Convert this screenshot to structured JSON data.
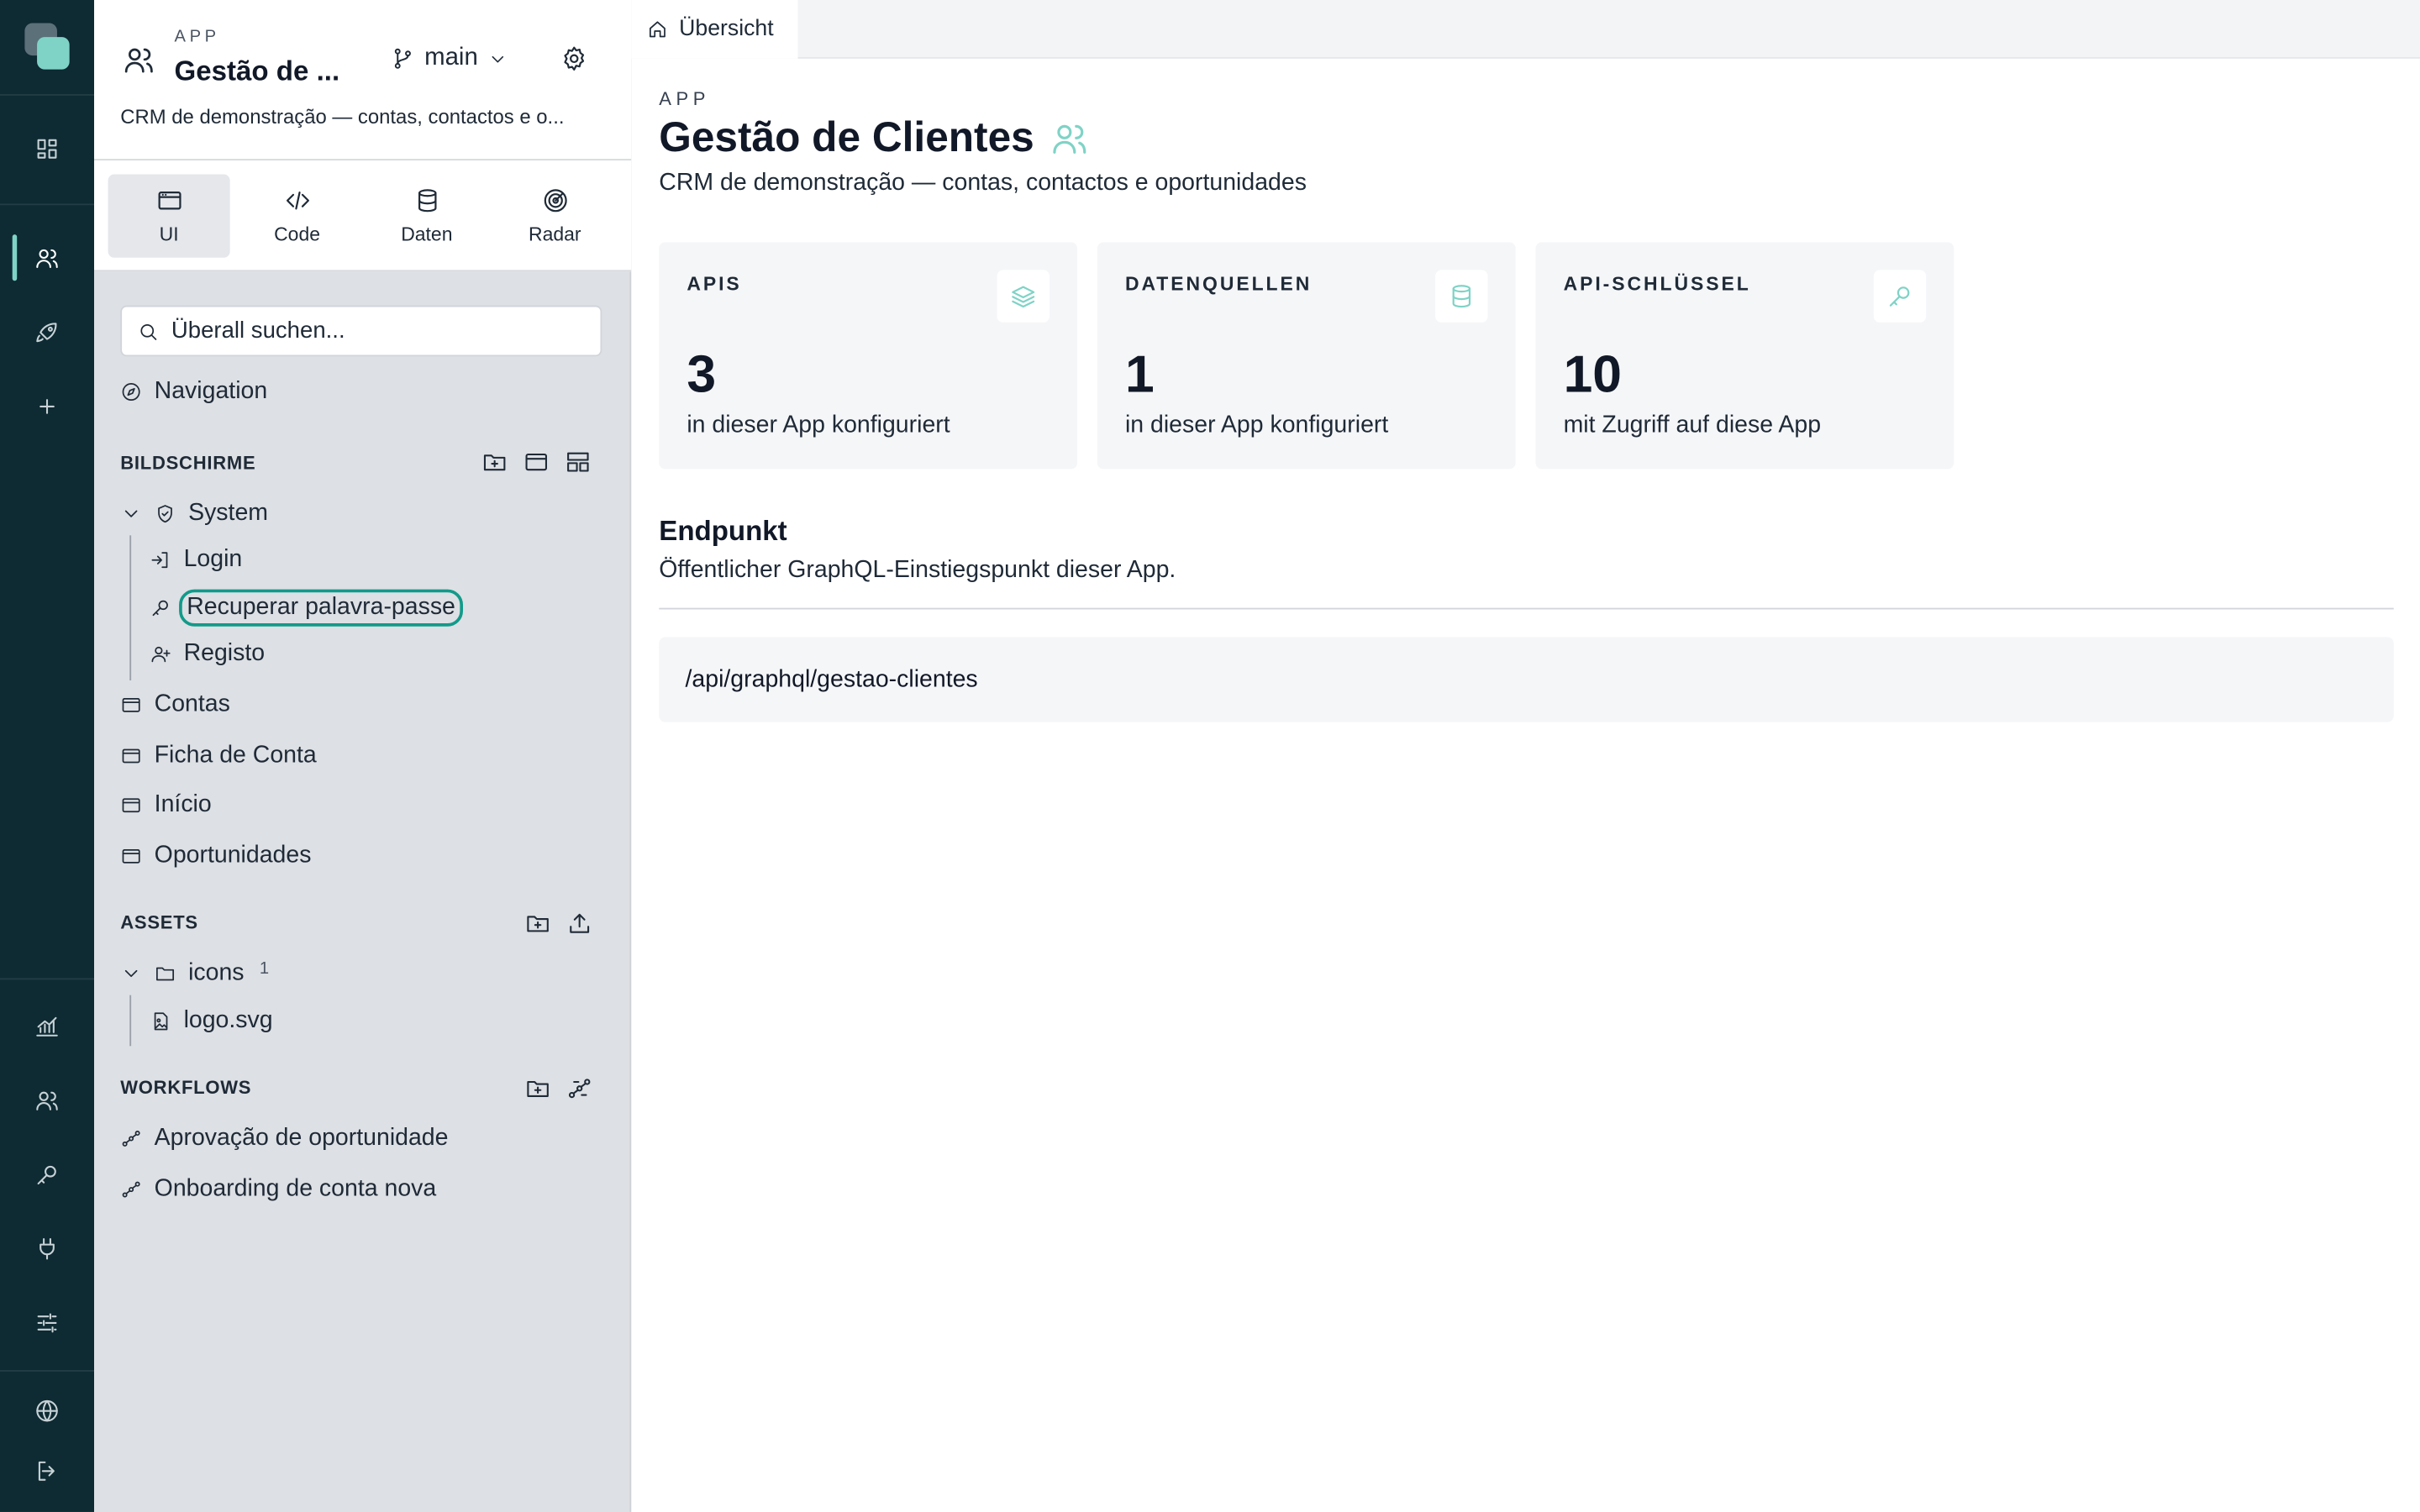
{
  "rail": {
    "items": [
      {
        "icon": "dashboard-icon"
      },
      {
        "icon": "users-icon"
      },
      {
        "icon": "rocket-icon"
      },
      {
        "icon": "plus-icon"
      },
      {
        "icon": "analytics-icon"
      },
      {
        "icon": "team-icon"
      },
      {
        "icon": "key-icon"
      },
      {
        "icon": "plug-icon"
      },
      {
        "icon": "sliders-icon"
      },
      {
        "icon": "globe-icon"
      },
      {
        "icon": "logout-icon"
      }
    ],
    "accent": "#7fd3c6"
  },
  "app": {
    "kicker": "APP",
    "name": "Gestão de ...",
    "branch": "main",
    "description": "CRM de demonstração — contas, contactos e o..."
  },
  "tabs": [
    {
      "label": "UI",
      "icon": "window-icon",
      "active": true
    },
    {
      "label": "Code",
      "icon": "code-icon",
      "active": false
    },
    {
      "label": "Daten",
      "icon": "database-icon",
      "active": false
    },
    {
      "label": "Radar",
      "icon": "radar-icon",
      "active": false
    }
  ],
  "search": {
    "placeholder": "Überall suchen..."
  },
  "nav": {
    "label": "Navigation"
  },
  "screens": {
    "heading": "BILDSCHIRME",
    "group": "System",
    "group_children": [
      "Login",
      "Recuperar palavra-passe",
      "Registo"
    ],
    "items": [
      "Contas",
      "Ficha de Conta",
      "Início",
      "Oportunidades"
    ]
  },
  "assets": {
    "heading": "ASSETS",
    "folder": "icons",
    "folder_count": "1",
    "file": "logo.svg"
  },
  "workflows": {
    "heading": "WORKFLOWS",
    "items": [
      "Aprovação de oportunidade",
      "Onboarding de conta nova"
    ]
  },
  "main": {
    "tab": "Übersicht",
    "kicker": "APP",
    "title": "Gestão de Clientes",
    "description": "CRM de demonstração — contas, contactos e oportunidades",
    "cards": [
      {
        "label": "APIS",
        "value": "3",
        "sub": "in dieser App konfiguriert",
        "icon": "layers-icon"
      },
      {
        "label": "DATENQUELLEN",
        "value": "1",
        "sub": "in dieser App konfiguriert",
        "icon": "database-icon"
      },
      {
        "label": "API-SCHLÜSSEL",
        "value": "10",
        "sub": "mit Zugriff auf diese App",
        "icon": "key-icon"
      }
    ],
    "endpoint": {
      "title": "Endpunkt",
      "description": "Öffentlicher GraphQL-Einstiegspunkt dieser App.",
      "url": "/api/graphql/gestao-clientes"
    }
  }
}
